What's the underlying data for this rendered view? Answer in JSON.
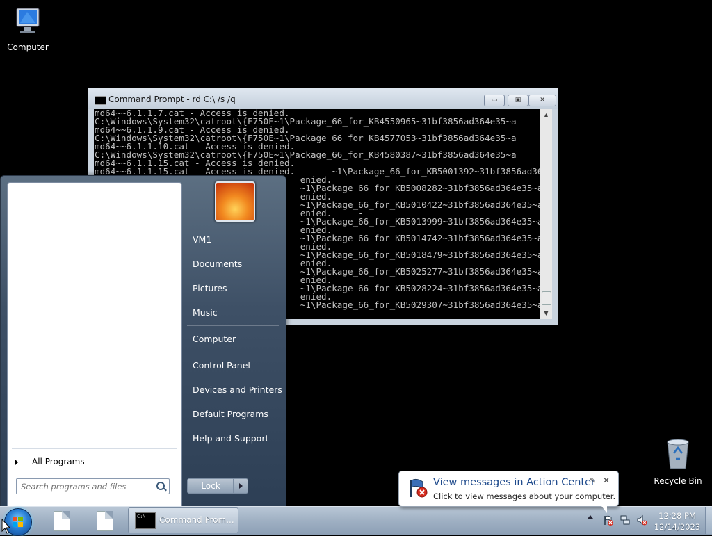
{
  "desktop": {
    "computer_label": "Computer",
    "recycle_label": "Recycle Bin"
  },
  "cmd_window": {
    "title": "Command Prompt - rd  C:\\ /s /q",
    "min_glyph": "▭",
    "max_glyph": "▣",
    "close_glyph": "✕",
    "lines": [
      "md64~~6.1.1.7.cat - Access is denied.",
      "C:\\Windows\\System32\\catroot\\{F750E~1\\Package_66_for_KB4550965~31bf3856ad364e35~a",
      "md64~~6.1.1.9.cat - Access is denied.",
      "C:\\Windows\\System32\\catroot\\{F750E~1\\Package_66_for_KB4577053~31bf3856ad364e35~a",
      "md64~~6.1.1.10.cat - Access is denied.",
      "C:\\Windows\\System32\\catroot\\{F750E~1\\Package_66_for_KB4580387~31bf3856ad364e35~a",
      "md64~~6.1.1.15.cat - Access is denied.",
      "md64~~6.1.1.15.cat - Access is denied.       ~1\\Package_66_for_KB5001392~31bf3856ad364e35~a",
      "                                       enied.",
      "                                       ~1\\Package_66_for_KB5008282~31bf3856ad364e35~a",
      "                                       enied.",
      "                                       ~1\\Package_66_for_KB5010422~31bf3856ad364e35~a",
      "                                       enied.     -",
      "                                       ~1\\Package_66_for_KB5013999~31bf3856ad364e35~a",
      "                                       enied.",
      "                                       ~1\\Package_66_for_KB5014742~31bf3856ad364e35~a",
      "                                       enied.",
      "                                       ~1\\Package_66_for_KB5018479~31bf3856ad364e35~a",
      "                                       enied.",
      "                                       ~1\\Package_66_for_KB5025277~31bf3856ad364e35~a",
      "                                       enied.",
      "                                       ~1\\Package_66_for_KB5028224~31bf3856ad364e35~a",
      "                                       enied.",
      "                                       ~1\\Package_66_for_KB5029307~31bf3856ad364e35~a"
    ]
  },
  "start_menu": {
    "all_programs": "All Programs",
    "search_placeholder": "Search programs and files",
    "right_items": [
      "VM1",
      "Documents",
      "Pictures",
      "Music",
      "Computer",
      "Control Panel",
      "Devices and Printers",
      "Default Programs",
      "Help and Support"
    ],
    "lock_label": "Lock"
  },
  "taskbar": {
    "task_label": "Command Prom...",
    "time": "12:28 PM",
    "date": "12/14/2023"
  },
  "balloon": {
    "title": "View messages in Action Center",
    "message": "Click to view messages about your computer.",
    "close_glyph": "✕",
    "wrench_glyph": "✎"
  },
  "colors": {
    "desktop_bg": "#000000",
    "balloon_title": "#1e4a8c",
    "taskbar": "#9fb0c3"
  }
}
